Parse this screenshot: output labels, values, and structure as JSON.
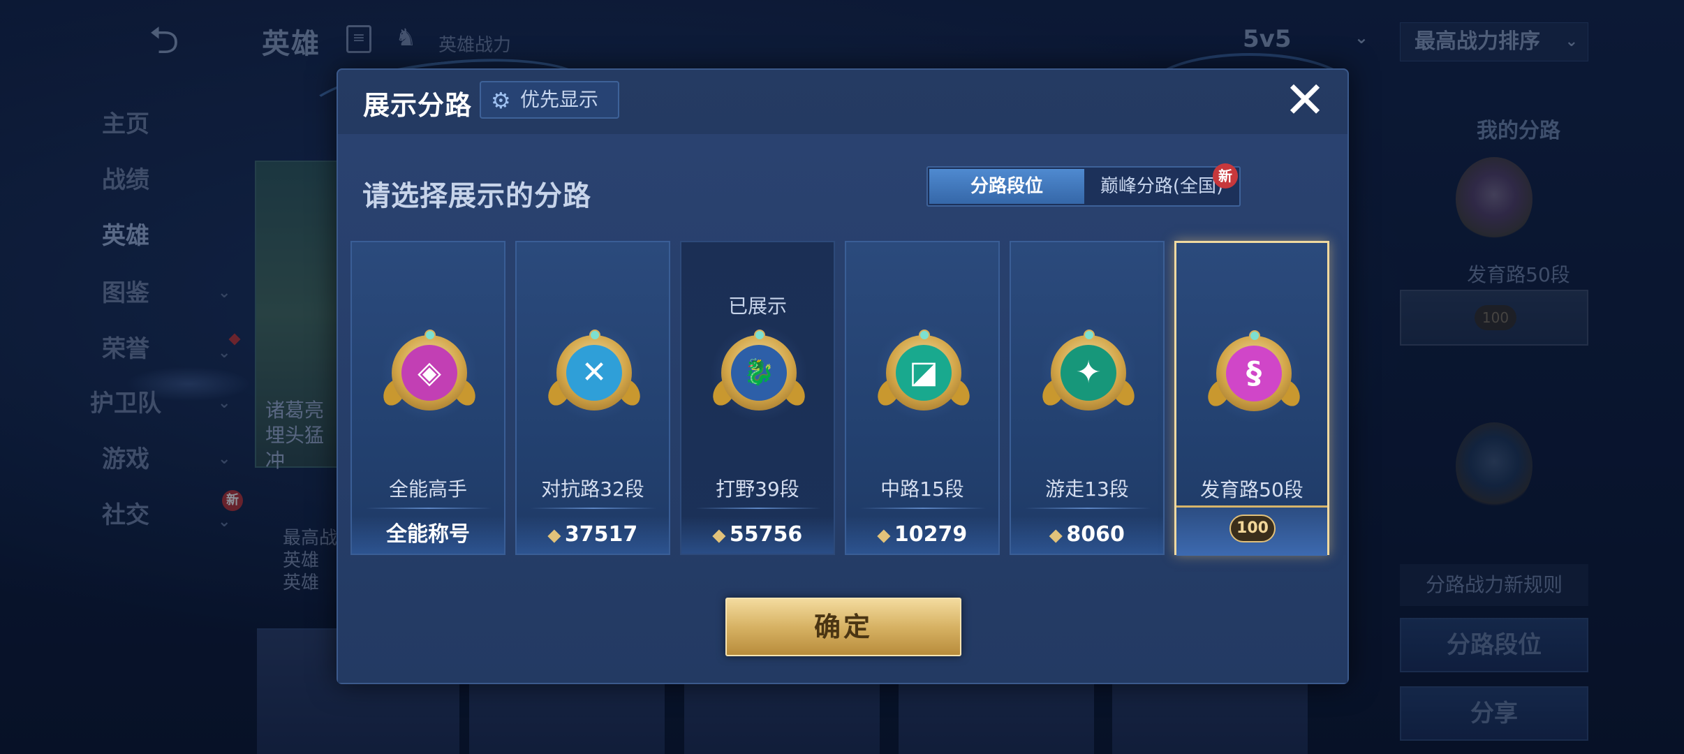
{
  "topbar": {
    "back_icon": "back-arrow-icon",
    "title": "英雄",
    "list_icon": "list-icon",
    "power_label": "英雄战力",
    "mode": "5v5",
    "sort": "最高战力排序"
  },
  "sidebar": {
    "items": [
      {
        "label": "主页",
        "chevron": false
      },
      {
        "label": "战绩",
        "chevron": false
      },
      {
        "label": "英雄",
        "chevron": false,
        "active": true
      },
      {
        "label": "图鉴",
        "chevron": true
      },
      {
        "label": "荣誉",
        "chevron": true,
        "dot": true
      },
      {
        "label": "护卫队",
        "chevron": true
      },
      {
        "label": "游戏",
        "chevron": true
      },
      {
        "label": "社交",
        "chevron": true,
        "new": "新"
      }
    ]
  },
  "background_hero": {
    "name_peek": "诸葛亮\n埋头猛冲",
    "info_lines": [
      "最高战",
      "英雄",
      "英雄"
    ]
  },
  "right_panel": {
    "title": "我的分路",
    "lane": "发育路50段",
    "rank_cap": "100",
    "rule_button": "分路战力新规则",
    "lane_rank_button": "分路段位",
    "share_button": "分享"
  },
  "modal": {
    "title": "展示分路",
    "priority_button": "优先显示",
    "prompt": "请选择展示的分路",
    "tabs": [
      {
        "label": "分路段位",
        "active": true
      },
      {
        "label": "巅峰分路(全国)",
        "new_badge": "新"
      }
    ],
    "cards": [
      {
        "lane": "全能高手",
        "footer": "全能称号",
        "has_power": false,
        "emblem_color": "#c23fb4",
        "glyph": "◈"
      },
      {
        "lane": "对抗路32段",
        "footer": "37517",
        "has_power": true,
        "emblem_color": "#2f9fd8",
        "glyph": "✕"
      },
      {
        "lane": "打野39段",
        "footer": "55756",
        "has_power": true,
        "emblem_color": "#2d5fa8",
        "glyph": "🐉",
        "shown": "已展示",
        "dark": true
      },
      {
        "lane": "中路15段",
        "footer": "10279",
        "has_power": true,
        "emblem_color": "#19a98e",
        "glyph": "◪"
      },
      {
        "lane": "游走13段",
        "footer": "8060",
        "has_power": true,
        "emblem_color": "#17977a",
        "glyph": "✦"
      },
      {
        "lane": "发育路50段",
        "footer": "100",
        "has_power": false,
        "emblem_color": "#d046c8",
        "glyph": "§",
        "selected": true
      }
    ],
    "confirm_button": "确定",
    "close_icon": "close-icon"
  }
}
